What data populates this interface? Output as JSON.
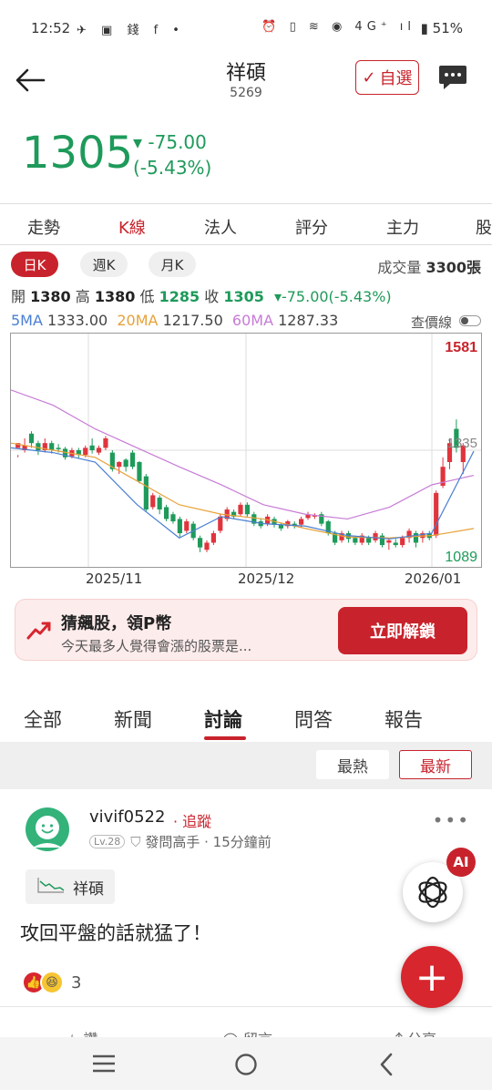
{
  "status": {
    "time": "12:52",
    "left_icons": "✈ ▣ 錢 f •",
    "right_icons": "⏰ ▯ ≋ ◉ 4G⁺ ıl",
    "battery": "51%"
  },
  "header": {
    "title": "祥碩",
    "code": "5269",
    "watch_label": "自選"
  },
  "quote": {
    "price": "1305",
    "change": "▾ -75.00",
    "change_pct": "(-5.43%)"
  },
  "tabs": [
    "走勢",
    "K線",
    "法人",
    "評分",
    "主力",
    "股"
  ],
  "ktypes": [
    "日K",
    "週K",
    "月K"
  ],
  "volume_label": "成交量",
  "volume_value": "3300張",
  "ohlc": {
    "open_label": "開",
    "open": "1380",
    "high_label": "高",
    "high": "1380",
    "low_label": "低",
    "low": "1285",
    "close_label": "收",
    "close": "1305",
    "chg": "-75.00(-5.43%)"
  },
  "ma": {
    "ma5_label": "5MA",
    "ma5": "1333.00",
    "ma20_label": "20MA",
    "ma20": "1217.50",
    "ma60_label": "60MA",
    "ma60": "1287.33",
    "ma5_color": "#4a7fd4",
    "ma20_color": "#e8a23a",
    "ma60_color": "#c77bd6"
  },
  "toggle_label": "查價線",
  "chart_data": {
    "type": "candlestick",
    "ymax_label": "1581",
    "ymin_label": "1089",
    "last_label": "1335",
    "x_labels": [
      "2025/11",
      "2025/12",
      "2026/01"
    ],
    "up_color": "#e0343d",
    "down_color": "#1e9a5a",
    "candles": [
      [
        1340,
        1350,
        1325,
        1320
      ],
      [
        1335,
        1345,
        1360,
        1330
      ],
      [
        1370,
        1350,
        1375,
        1340
      ],
      [
        1350,
        1335,
        1355,
        1325
      ],
      [
        1335,
        1350,
        1360,
        1330
      ],
      [
        1350,
        1335,
        1355,
        1328
      ],
      [
        1340,
        1338,
        1348,
        1330
      ],
      [
        1338,
        1320,
        1342,
        1315
      ],
      [
        1322,
        1335,
        1340,
        1318
      ],
      [
        1335,
        1325,
        1340,
        1318
      ],
      [
        1325,
        1340,
        1345,
        1320
      ],
      [
        1345,
        1335,
        1360,
        1328
      ],
      [
        1330,
        1340,
        1345,
        1325
      ],
      [
        1340,
        1360,
        1365,
        1335
      ],
      [
        1330,
        1295,
        1335,
        1290
      ],
      [
        1300,
        1310,
        1312,
        1285
      ],
      [
        1315,
        1300,
        1318,
        1290
      ],
      [
        1330,
        1300,
        1335,
        1295
      ],
      [
        1310,
        1270,
        1312,
        1265
      ],
      [
        1280,
        1210,
        1285,
        1205
      ],
      [
        1215,
        1240,
        1245,
        1210
      ],
      [
        1235,
        1210,
        1240,
        1200
      ],
      [
        1215,
        1190,
        1220,
        1185
      ],
      [
        1200,
        1185,
        1205,
        1180
      ],
      [
        1190,
        1160,
        1195,
        1150
      ],
      [
        1165,
        1185,
        1190,
        1160
      ],
      [
        1180,
        1150,
        1185,
        1145
      ],
      [
        1150,
        1130,
        1155,
        1120
      ],
      [
        1125,
        1140,
        1145,
        1120
      ],
      [
        1140,
        1160,
        1165,
        1135
      ],
      [
        1165,
        1195,
        1200,
        1160
      ],
      [
        1190,
        1210,
        1215,
        1185
      ],
      [
        1205,
        1195,
        1210,
        1190
      ],
      [
        1200,
        1220,
        1225,
        1195
      ],
      [
        1220,
        1200,
        1225,
        1195
      ],
      [
        1200,
        1180,
        1205,
        1175
      ],
      [
        1185,
        1175,
        1190,
        1170
      ],
      [
        1180,
        1195,
        1200,
        1175
      ],
      [
        1190,
        1178,
        1195,
        1172
      ],
      [
        1178,
        1170,
        1182,
        1165
      ],
      [
        1175,
        1185,
        1188,
        1170
      ],
      [
        1180,
        1175,
        1185,
        1170
      ],
      [
        1178,
        1190,
        1195,
        1172
      ],
      [
        1192,
        1200,
        1205,
        1188
      ],
      [
        1195,
        1198,
        1202,
        1190
      ],
      [
        1200,
        1180,
        1205,
        1175
      ],
      [
        1185,
        1160,
        1188,
        1155
      ],
      [
        1160,
        1140,
        1165,
        1135
      ],
      [
        1145,
        1160,
        1165,
        1140
      ],
      [
        1160,
        1148,
        1165,
        1140
      ],
      [
        1150,
        1140,
        1155,
        1135
      ],
      [
        1140,
        1155,
        1160,
        1135
      ],
      [
        1150,
        1140,
        1155,
        1135
      ],
      [
        1145,
        1160,
        1165,
        1140
      ],
      [
        1155,
        1135,
        1160,
        1130
      ],
      [
        1140,
        1145,
        1150,
        1125
      ],
      [
        1140,
        1135,
        1148,
        1130
      ],
      [
        1135,
        1150,
        1155,
        1130
      ],
      [
        1150,
        1165,
        1170,
        1140
      ],
      [
        1160,
        1140,
        1165,
        1130
      ],
      [
        1150,
        1160,
        1165,
        1140
      ],
      [
        1160,
        1150,
        1165,
        1145
      ],
      [
        1155,
        1245,
        1250,
        1150
      ],
      [
        1260,
        1300,
        1320,
        1255
      ],
      [
        1310,
        1350,
        1360,
        1295
      ],
      [
        1380,
        1340,
        1400,
        1330
      ],
      [
        1310,
        1345,
        1350,
        1285
      ]
    ],
    "ma60": [
      1462,
      1430,
      1380,
      1340,
      1300,
      1262,
      1220,
      1200,
      1190,
      1215,
      1262,
      1282
    ],
    "ma20": [
      1350,
      1335,
      1320,
      1270,
      1220,
      1200,
      1190,
      1170,
      1152,
      1150,
      1155,
      1170
    ],
    "ma5": [
      1340,
      1330,
      1310,
      1220,
      1150,
      1195,
      1180,
      1175,
      1155,
      1148,
      1160,
      1333
    ]
  },
  "banner": {
    "title": "猜飆股，領P幣",
    "subtitle": "今天最多人覺得會漲的股票是...",
    "button": "立即解鎖"
  },
  "content_tabs": [
    "全部",
    "新聞",
    "討論",
    "問答",
    "報告"
  ],
  "sort": {
    "hot": "最熱",
    "new": "最新"
  },
  "post": {
    "username": "vivif0522",
    "follow": "追蹤",
    "level": "Lv.28",
    "badge": "發問高手",
    "time": "15分鐘前",
    "stock_tag": "祥碩",
    "content": "攻回平盤的話就猛了！",
    "reaction_count": "3",
    "like_label": "讚",
    "comment_label": "留言",
    "share_label": "分享"
  },
  "ai_badge": "AI"
}
